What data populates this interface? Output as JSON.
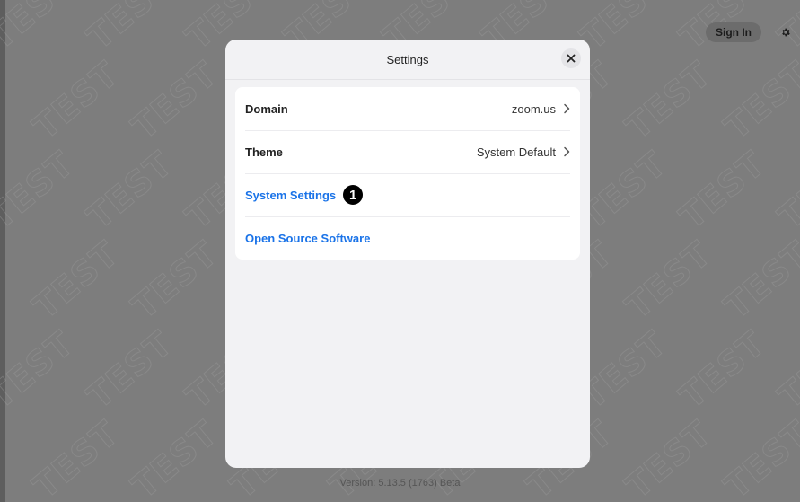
{
  "header": {
    "sign_in_label": "Sign In",
    "settings_icon": "gear-icon"
  },
  "watermark": "TEST",
  "modal": {
    "title": "Settings",
    "close_icon": "close-icon",
    "rows": [
      {
        "label": "Domain",
        "value": "zoom.us"
      },
      {
        "label": "Theme",
        "value": "System Default"
      },
      {
        "label": "System Settings",
        "badge": "1"
      },
      {
        "label": "Open Source Software"
      }
    ]
  },
  "footer": {
    "version": "Version: 5.13.5 (1763) Beta"
  },
  "colors": {
    "link": "#1a73e8",
    "backdrop": "#7d7d7d",
    "modal_bg": "#f2f2f4"
  }
}
